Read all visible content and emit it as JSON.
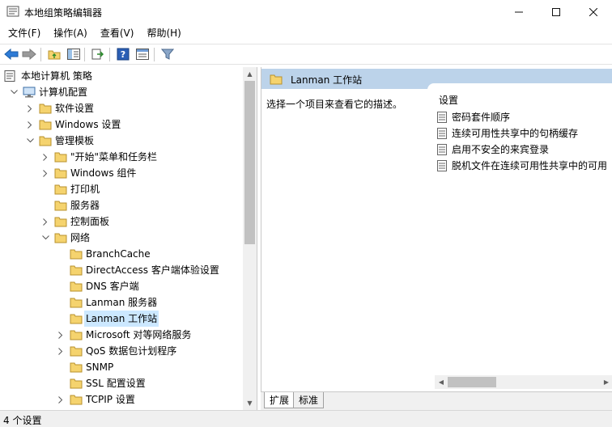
{
  "window": {
    "title": "本地组策略编辑器"
  },
  "menu": {
    "items": [
      "文件(F)",
      "操作(A)",
      "查看(V)",
      "帮助(H)"
    ]
  },
  "toolbar": {
    "icons": [
      "back-arrow-icon",
      "forward-arrow-icon",
      "up-folder-icon",
      "show-hide-tree-icon",
      "export-list-icon",
      "help-icon",
      "properties-icon",
      "filter-icon"
    ]
  },
  "tree": {
    "items": [
      {
        "label": "本地计算机 策略",
        "level": 0,
        "expander": "none",
        "icon": "policy"
      },
      {
        "label": "计算机配置",
        "level": 1,
        "expander": "expanded",
        "icon": "computer"
      },
      {
        "label": "软件设置",
        "level": 2,
        "expander": "collapsed",
        "icon": "folder"
      },
      {
        "label": "Windows 设置",
        "level": 2,
        "expander": "collapsed",
        "icon": "folder"
      },
      {
        "label": "管理模板",
        "level": 2,
        "expander": "expanded",
        "icon": "folder"
      },
      {
        "label": "\"开始\"菜单和任务栏",
        "level": 3,
        "expander": "collapsed",
        "icon": "folder"
      },
      {
        "label": "Windows 组件",
        "level": 3,
        "expander": "collapsed",
        "icon": "folder"
      },
      {
        "label": "打印机",
        "level": 3,
        "expander": "none",
        "icon": "folder"
      },
      {
        "label": "服务器",
        "level": 3,
        "expander": "none",
        "icon": "folder"
      },
      {
        "label": "控制面板",
        "level": 3,
        "expander": "collapsed",
        "icon": "folder"
      },
      {
        "label": "网络",
        "level": 3,
        "expander": "expanded",
        "icon": "folder"
      },
      {
        "label": "BranchCache",
        "level": 4,
        "expander": "none",
        "icon": "folder"
      },
      {
        "label": "DirectAccess 客户端体验设置",
        "level": 4,
        "expander": "none",
        "icon": "folder"
      },
      {
        "label": "DNS 客户端",
        "level": 4,
        "expander": "none",
        "icon": "folder"
      },
      {
        "label": "Lanman 服务器",
        "level": 4,
        "expander": "none",
        "icon": "folder"
      },
      {
        "label": "Lanman 工作站",
        "level": 4,
        "expander": "none",
        "icon": "folder",
        "selected": true
      },
      {
        "label": "Microsoft 对等网络服务",
        "level": 4,
        "expander": "collapsed",
        "icon": "folder"
      },
      {
        "label": "QoS 数据包计划程序",
        "level": 4,
        "expander": "collapsed",
        "icon": "folder"
      },
      {
        "label": "SNMP",
        "level": 4,
        "expander": "none",
        "icon": "folder"
      },
      {
        "label": "SSL 配置设置",
        "level": 4,
        "expander": "none",
        "icon": "folder"
      },
      {
        "label": "TCPIP 设置",
        "level": 4,
        "expander": "collapsed",
        "icon": "folder"
      }
    ]
  },
  "details": {
    "header": "Lanman 工作站",
    "description": "选择一个项目来查看它的描述。",
    "column": "设置",
    "settings": [
      "密码套件顺序",
      "连续可用性共享中的句柄缓存",
      "启用不安全的来宾登录",
      "脱机文件在连续可用性共享中的可用"
    ]
  },
  "tabs": [
    "扩展",
    "标准"
  ],
  "status": {
    "text": "4 个设置"
  },
  "colors": {
    "header_bg": "#bcd3ea",
    "selection_bg": "#cce8ff",
    "folder_yellow": "#f5d36e"
  }
}
